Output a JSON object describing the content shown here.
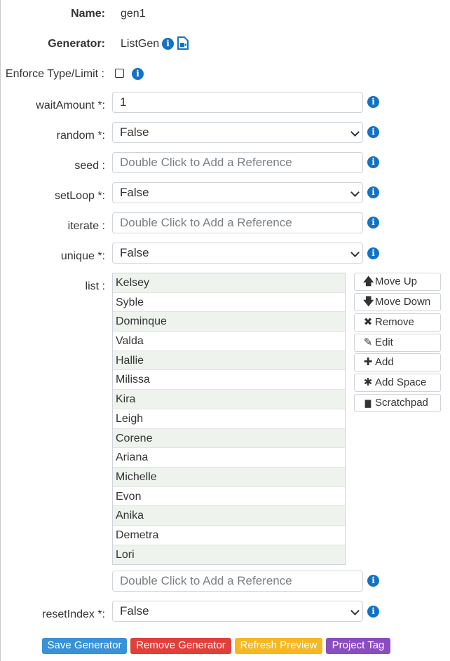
{
  "fields": {
    "name_label": "Name:",
    "name_value": "gen1",
    "generator_label": "Generator:",
    "generator_value": "ListGen",
    "enforce_label": "Enforce Type/Limit :",
    "waitAmount_label": "waitAmount *:",
    "waitAmount_value": "1",
    "random_label": "random *:",
    "random_value": "False",
    "seed_label": "seed :",
    "seed_placeholder": "Double Click to Add a Reference",
    "setLoop_label": "setLoop *:",
    "setLoop_value": "False",
    "iterate_label": "iterate :",
    "iterate_placeholder": "Double Click to Add a Reference",
    "unique_label": "unique *:",
    "unique_value": "False",
    "list_label": "list :",
    "list_ref_placeholder": "Double Click to Add a Reference",
    "resetIndex_label": "resetIndex *:",
    "resetIndex_value": "False",
    "enforce_checked": false
  },
  "list_items": [
    "Kelsey",
    "Syble",
    "Dominque",
    "Valda",
    "Hallie",
    "Milissa",
    "Kira",
    "Leigh",
    "Corene",
    "Ariana",
    "Michelle",
    "Evon",
    "Anika",
    "Demetra",
    "Lori"
  ],
  "list_buttons": [
    {
      "icon": "arrow-up-icon",
      "glyph": "🡅",
      "label": "Move Up"
    },
    {
      "icon": "arrow-down-icon",
      "glyph": "🡇",
      "label": "Move Down"
    },
    {
      "icon": "x-icon",
      "glyph": "✖",
      "label": "Remove"
    },
    {
      "icon": "pencil-icon",
      "glyph": "✎",
      "label": "Edit"
    },
    {
      "icon": "plus-icon",
      "glyph": "✚",
      "label": "Add"
    },
    {
      "icon": "asterisk-icon",
      "glyph": "✱",
      "label": "Add Space"
    },
    {
      "icon": "file-icon",
      "glyph": "▇",
      "label": "Scratchpad"
    }
  ],
  "footer": {
    "save": "Save Generator",
    "remove": "Remove Generator",
    "refresh": "Refresh Preview",
    "tag": "Project Tag"
  },
  "colors": {
    "info": "#1273c3",
    "save": "#3792d6",
    "remove": "#e0403a",
    "refresh": "#f5b821",
    "tag": "#8a4dbf"
  }
}
